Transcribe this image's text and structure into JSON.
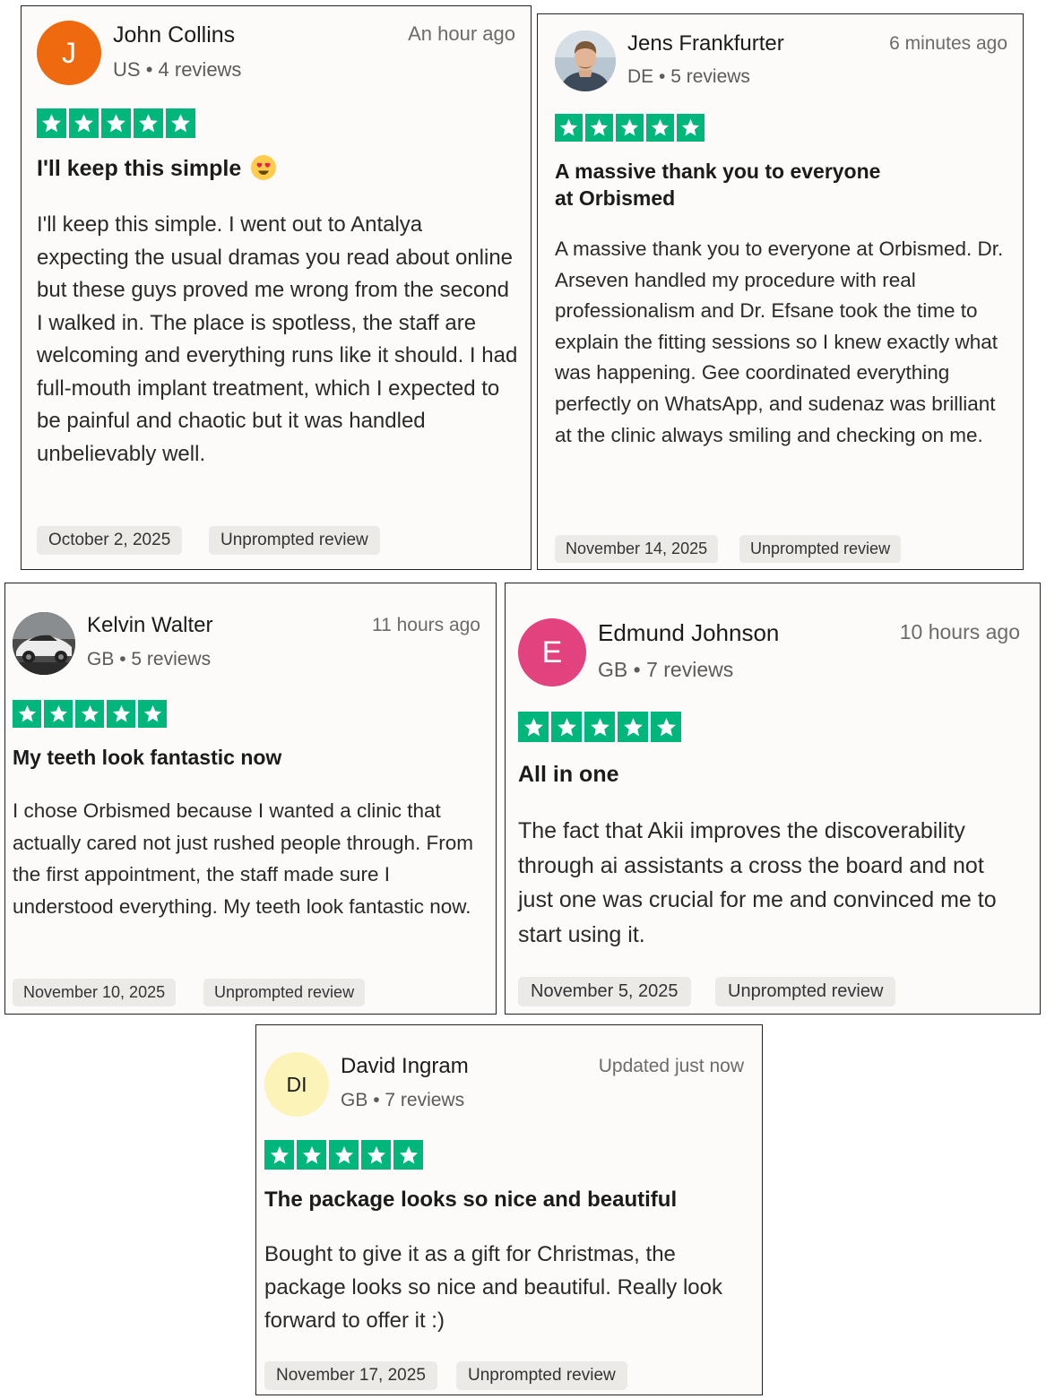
{
  "colors": {
    "star_green": "#00b67a",
    "avatar_john": "#ef6a0e",
    "avatar_edmund": "#e2427d",
    "avatar_david": "#fbf3b8"
  },
  "reviews": [
    {
      "name": "John Collins",
      "country": "US",
      "review_count": "4 reviews",
      "time": "An hour ago",
      "avatar_initials": "J",
      "rating": 5,
      "title": "I'll keep this simple",
      "title_emoji": "heart-eyes-emoji",
      "body": "I'll keep this simple. I went out to Antalya expecting the usual dramas you read about online but these guys proved me wrong from the second I walked in. The place is spotless, the staff are welcoming and everything runs like it should. I had full-mouth implant treatment, which I expected to be painful and chaotic but it was handled unbelievably well.",
      "date": "October 2, 2025",
      "badge": "Unprompted review"
    },
    {
      "name": "Jens Frankfurter",
      "country": "DE",
      "review_count": "5 reviews",
      "time": "6 minutes ago",
      "avatar_initials": "",
      "rating": 5,
      "title": "A massive thank you to everyone at Orbismed",
      "body": "A massive thank you to everyone at Orbismed. Dr. Arseven handled my procedure with real professionalism and Dr. Efsane took the time to explain the fitting sessions so I knew exactly what was happening. Gee coordinated everything perfectly on WhatsApp, and sudenaz was brilliant at the clinic always smiling and checking on me.",
      "date": "November 14, 2025",
      "badge": "Unprompted review"
    },
    {
      "name": "Kelvin Walter",
      "country": "GB",
      "review_count": "5 reviews",
      "time": "11 hours ago",
      "avatar_initials": "",
      "rating": 5,
      "title": "My teeth look fantastic now",
      "body": "I chose Orbismed because I wanted a clinic that actually cared not just rushed people through. From the first appointment, the staff made sure I understood everything. My teeth look fantastic now.",
      "date": "November 10, 2025",
      "badge": "Unprompted review"
    },
    {
      "name": "Edmund Johnson",
      "country": "GB",
      "review_count": "7 reviews",
      "time": "10 hours ago",
      "avatar_initials": "E",
      "rating": 5,
      "title": "All in one",
      "body": "The fact that Akii improves the discoverability through ai assistants a cross the board and not just one was crucial for me and convinced me to start using it.",
      "date": "November 5, 2025",
      "badge": "Unprompted review"
    },
    {
      "name": "David Ingram",
      "country": "GB",
      "review_count": "7 reviews",
      "time": "Updated just now",
      "avatar_initials": "DI",
      "rating": 5,
      "title": "The package looks so nice and beautiful",
      "body": "Bought to give it as a gift for Christmas, the package looks so nice and beautiful. Really look forward to offer it :)",
      "date": "November 17, 2025",
      "badge": "Unprompted review"
    }
  ],
  "separator": "•"
}
